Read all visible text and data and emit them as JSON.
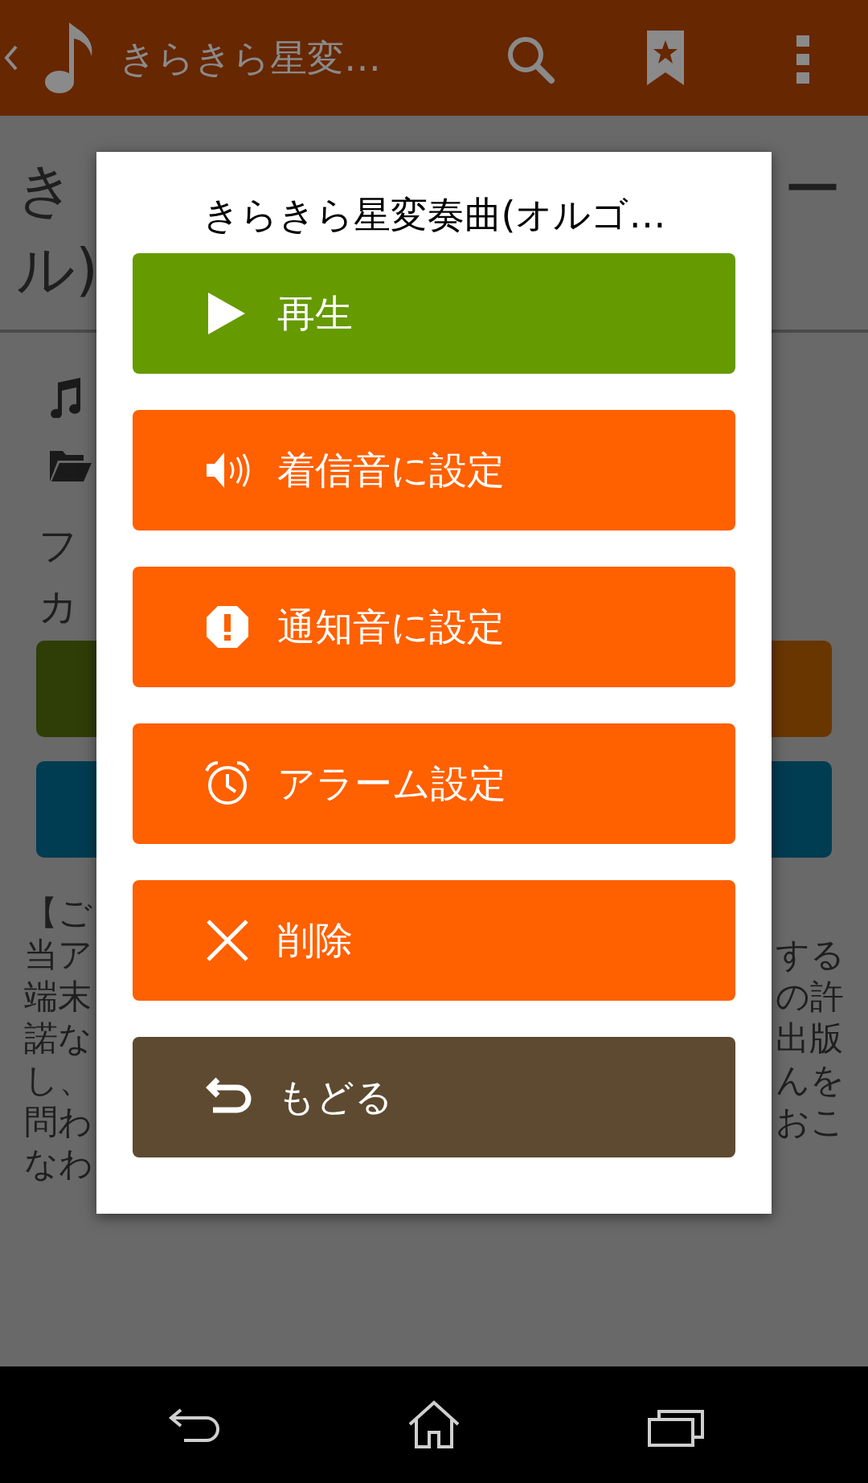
{
  "app_bar": {
    "title": "きらきら星変…"
  },
  "background": {
    "heading_left": [
      "き",
      "ル)"
    ],
    "heading_right": [
      "ー"
    ],
    "left_fragments": [
      "フ",
      "カ"
    ],
    "notice_left": [
      "【ご",
      "当ア",
      "端末",
      "諾な",
      "し、",
      "問わ",
      "なわ"
    ],
    "notice_right": [
      "する",
      "の許",
      "出版",
      "んを",
      "おこ"
    ]
  },
  "dialog": {
    "title": "きらきら星変奏曲(オルゴ…",
    "buttons": [
      {
        "kind": "play",
        "label": "再生",
        "color": "#659a00"
      },
      {
        "kind": "ringtone",
        "label": "着信音に設定",
        "color": "#ff6000"
      },
      {
        "kind": "notification",
        "label": "通知音に設定",
        "color": "#ff6000"
      },
      {
        "kind": "alarm",
        "label": "アラーム設定",
        "color": "#ff6000"
      },
      {
        "kind": "delete",
        "label": "削除",
        "color": "#ff6000"
      },
      {
        "kind": "back",
        "label": "もどる",
        "color": "#5e4a30"
      }
    ]
  }
}
